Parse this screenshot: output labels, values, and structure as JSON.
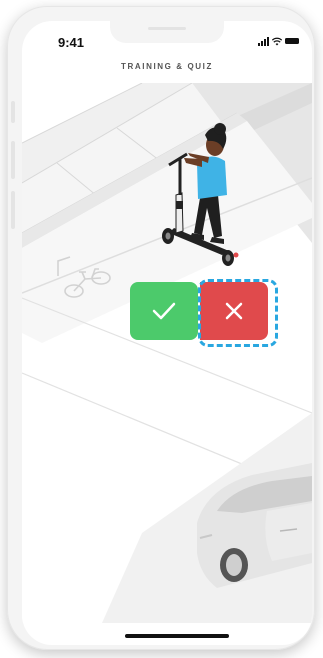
{
  "status_bar": {
    "time": "9:41"
  },
  "header": {
    "title": "TRAINING & QUIZ"
  },
  "quiz": {
    "correct_answer_icon": "checkmark-icon",
    "wrong_answer_icon": "cross-icon",
    "selected": "wrong"
  },
  "colors": {
    "correct": "#4CCA6B",
    "wrong": "#E04A4C",
    "selection_highlight": "#29A7E0",
    "rider_shirt": "#3FB3E6"
  }
}
